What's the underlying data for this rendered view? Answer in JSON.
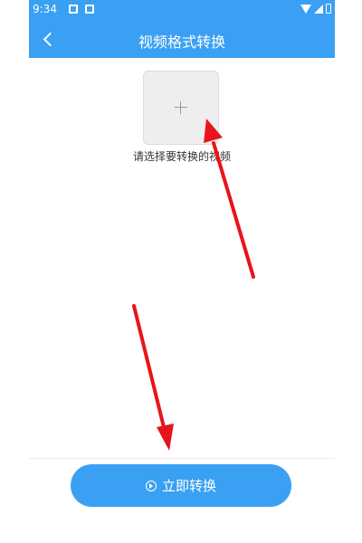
{
  "status_bar": {
    "time": "9:34",
    "icons": [
      "image-notification-icon",
      "notification-icon",
      "wifi-icon",
      "signal-icon",
      "battery-icon"
    ]
  },
  "title_bar": {
    "title": "视频格式转换",
    "back_icon": "chevron-left-icon"
  },
  "picker": {
    "icon": "plus-icon",
    "hint": "请选择要转换的视频"
  },
  "convert_button": {
    "icon": "play-circle-icon",
    "label": "立即转换"
  },
  "colors": {
    "accent": "#3aa0f3",
    "arrow": "#e8141b"
  }
}
